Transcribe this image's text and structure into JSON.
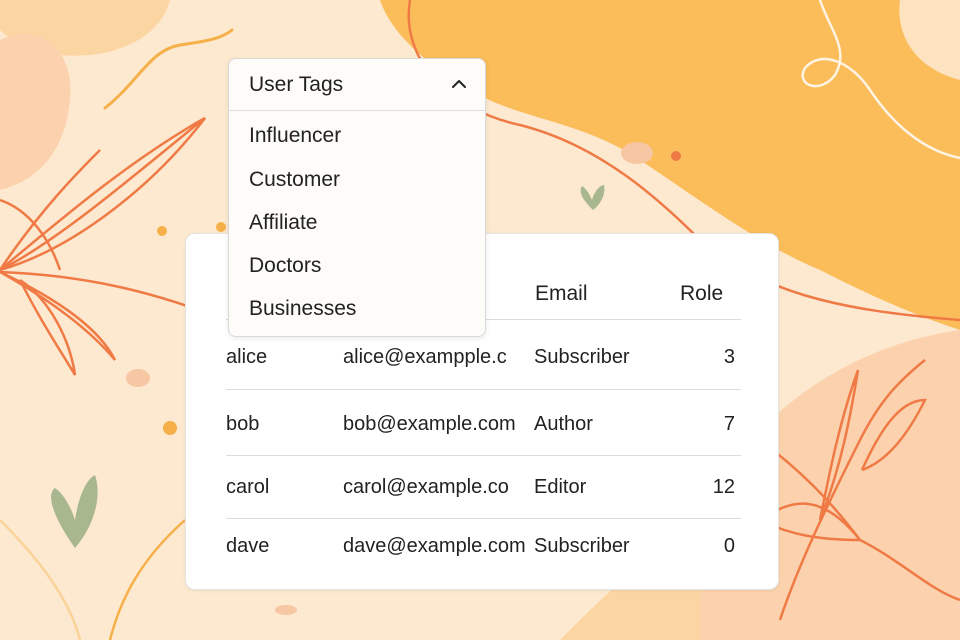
{
  "dropdown": {
    "title": "User Tags",
    "items": [
      "Influencer",
      "Customer",
      "Affiliate",
      "Doctors",
      "Businesses"
    ]
  },
  "table": {
    "headers": {
      "email": "Email",
      "role": "Role"
    },
    "rows": [
      {
        "name": "alice",
        "email": "alice@exampple.c",
        "role": "Subscriber",
        "count": "3"
      },
      {
        "name": "bob",
        "email": "bob@example.com",
        "role": "Author",
        "count": "7"
      },
      {
        "name": "carol",
        "email": "carol@example.co",
        "role": "Editor",
        "count": "12"
      },
      {
        "name": "dave",
        "email": "dave@example.com",
        "role": "Subscriber",
        "count": "0"
      }
    ]
  },
  "colors": {
    "background": "#fde9cf",
    "blob_orange": "#fbbd5a",
    "line_orange": "#f07a45",
    "leaf_green": "#a9b78f"
  },
  "icons": {
    "dropdown_toggle": "chevron-up-icon"
  }
}
